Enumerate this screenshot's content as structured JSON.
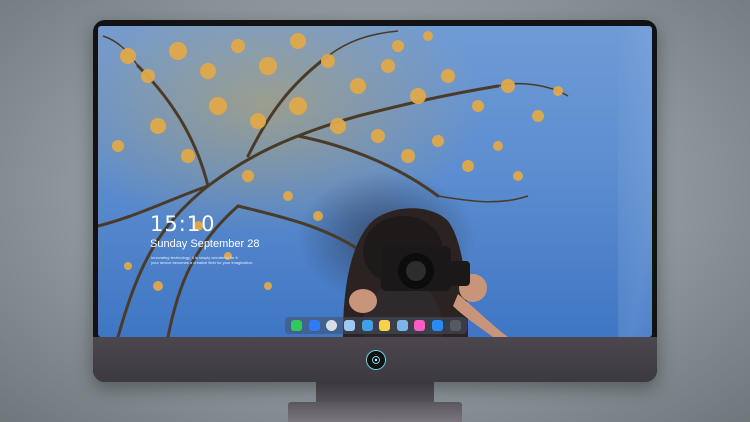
{
  "lock_screen": {
    "time": "15:10",
    "date": "Sunday September 28",
    "quote_line1": "Innovating technology, it is simply wonderful for it.",
    "quote_line2": "your device becomes a creative field for your imagination."
  },
  "dock": {
    "items": [
      {
        "icon": "messages-icon",
        "color": "#34c759"
      },
      {
        "icon": "files-icon",
        "color": "#2f7bf5"
      },
      {
        "icon": "safari-icon",
        "color": "#d8dde5"
      },
      {
        "icon": "photos-icon",
        "color": "#9ec8f0"
      },
      {
        "icon": "clapper-icon",
        "color": "#3ea0e8"
      },
      {
        "icon": "notes-icon",
        "color": "#f5d547"
      },
      {
        "icon": "preview-icon",
        "color": "#7cb6e8"
      },
      {
        "icon": "music-icon",
        "color": "#fb5bc5"
      },
      {
        "icon": "app-store-icon",
        "color": "#2a8cf2"
      },
      {
        "icon": "camera-icon",
        "color": "#555a60"
      }
    ]
  },
  "colors": {
    "monitor_bezel": "#121214",
    "monitor_chin": "#4c474f",
    "logo_accent": "#6ccfe0"
  }
}
